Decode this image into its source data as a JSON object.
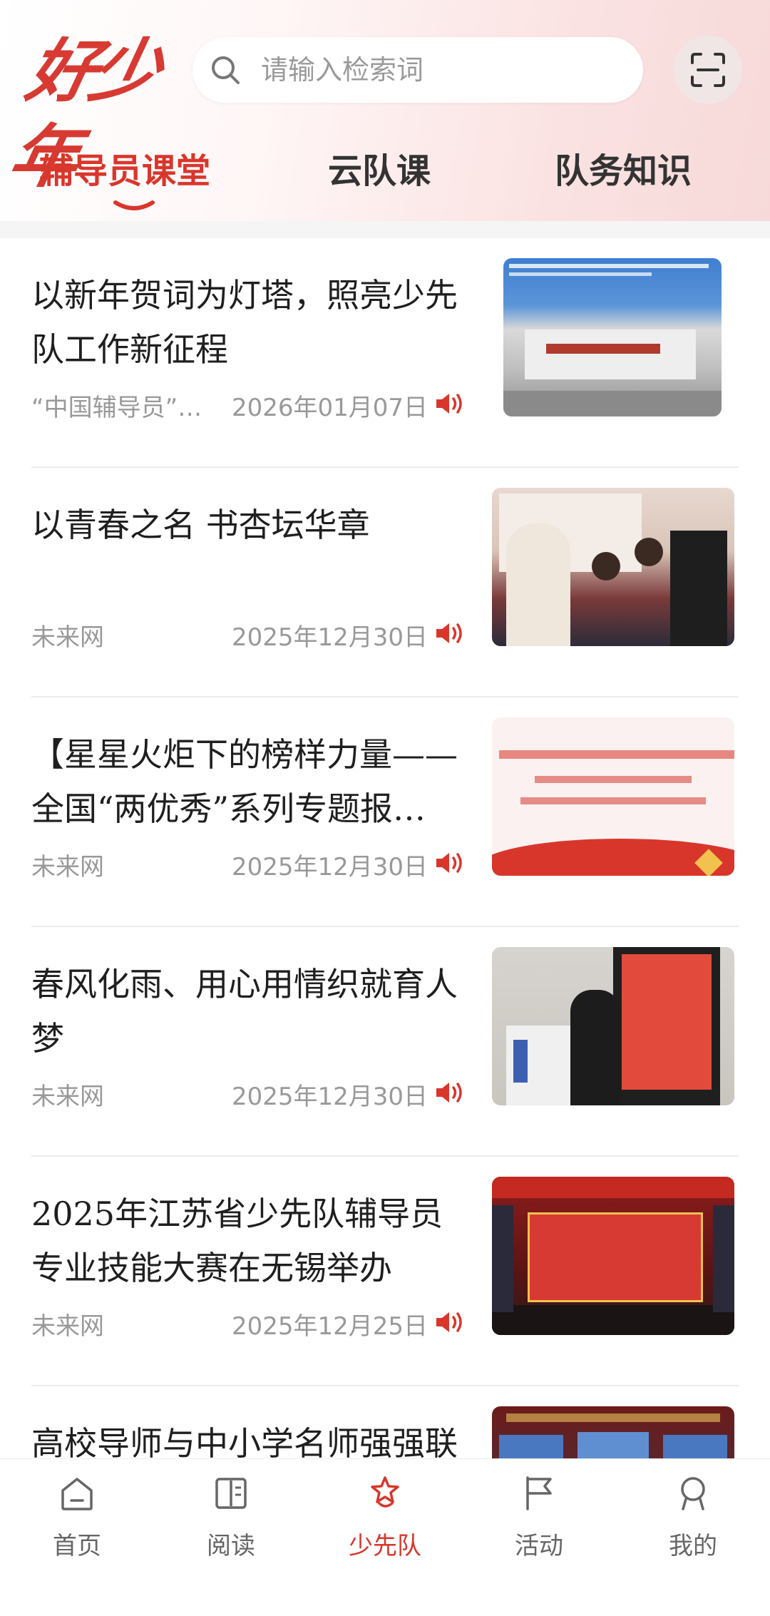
{
  "header": {
    "logo_text": "好少年",
    "search_placeholder": "请输入检索词",
    "scan_icon": "scan-icon"
  },
  "tabs": [
    {
      "label": "辅导员课堂",
      "active": true
    },
    {
      "label": "云队课",
      "active": false
    },
    {
      "label": "队务知识",
      "active": false
    }
  ],
  "articles": [
    {
      "title": "以新年贺词为灯塔，照亮少先队工作新征程",
      "source": "“中国辅导员”…",
      "date": "2026年01月07日"
    },
    {
      "title": "以青春之名  书杏坛华章",
      "source": "未来网",
      "date": "2025年12月30日"
    },
    {
      "title": "【星星火炬下的榜样力量——全国“两优秀”系列专题报…",
      "source": "未来网",
      "date": "2025年12月30日"
    },
    {
      "title": "春风化雨、用心用情织就育人梦",
      "source": "未来网",
      "date": "2025年12月30日"
    },
    {
      "title": "2025年江苏省少先队辅导员专业技能大赛在无锡举办",
      "source": "未来网",
      "date": "2025年12月25日"
    },
    {
      "title": "高校导师与中小学名师强强联",
      "source": "",
      "date": ""
    }
  ],
  "bottom_nav": [
    {
      "label": "首页",
      "icon": "home-icon",
      "active": false
    },
    {
      "label": "阅读",
      "icon": "book-icon",
      "active": false
    },
    {
      "label": "少先队",
      "icon": "star-torch-icon",
      "active": true
    },
    {
      "label": "活动",
      "icon": "flag-icon",
      "active": false
    },
    {
      "label": "我的",
      "icon": "user-icon",
      "active": false
    }
  ],
  "colors": {
    "accent": "#d9362b",
    "text": "#1f1f1f",
    "muted": "#999999"
  }
}
